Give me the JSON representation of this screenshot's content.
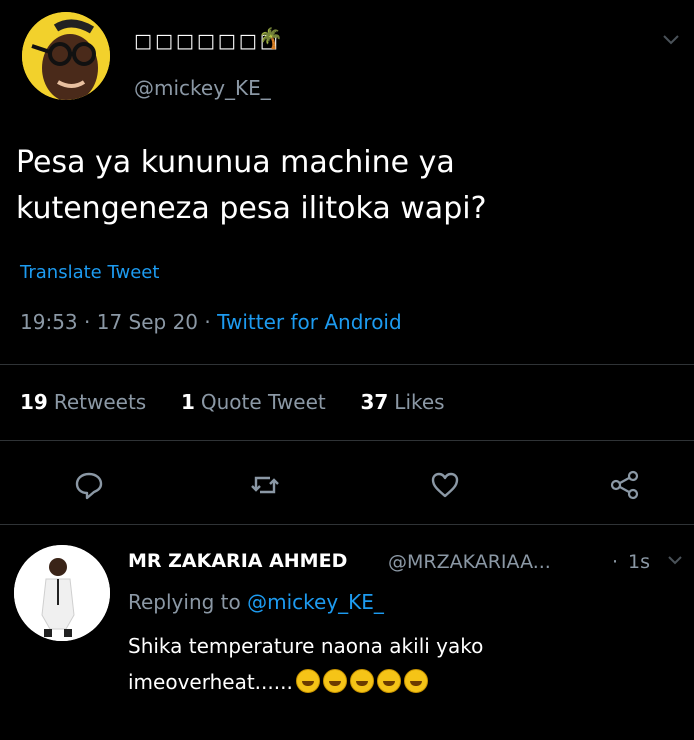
{
  "tweet": {
    "display_name": "□□□□□□□",
    "palm": "🌴",
    "handle": "@mickey_KE_",
    "text_line1": "Pesa ya kununua machine ya",
    "text_line2": "kutengeneza pesa ilitoka wapi?",
    "translate": "Translate Tweet",
    "time": "19:53",
    "date": "17 Sep 20",
    "sep": "·",
    "app": "Twitter for Android",
    "retweets_count": "19",
    "retweets_label": "Retweets",
    "quote_count": "1",
    "quote_label": "Quote Tweet",
    "likes_count": "37",
    "likes_label": "Likes"
  },
  "reply": {
    "name": "MR ZAKARIA AHMED",
    "handle": "@MRZAKARIAA...",
    "dot": "·",
    "time": "1s",
    "replying_prefix": "Replying to",
    "replying_mention": "@mickey_KE_",
    "text_line1": "Shika temperature naona akili yako",
    "text_line2": "imeoverheat......"
  },
  "icons": {
    "reply": "comment-bubble-icon",
    "retweet": "retweet-icon",
    "like": "heart-icon",
    "share": "share-icon"
  },
  "colors": {
    "background": "#000000",
    "accent": "#1d9bf0",
    "muted": "#8b98a5",
    "avatar_bg": "#f2d12c"
  }
}
